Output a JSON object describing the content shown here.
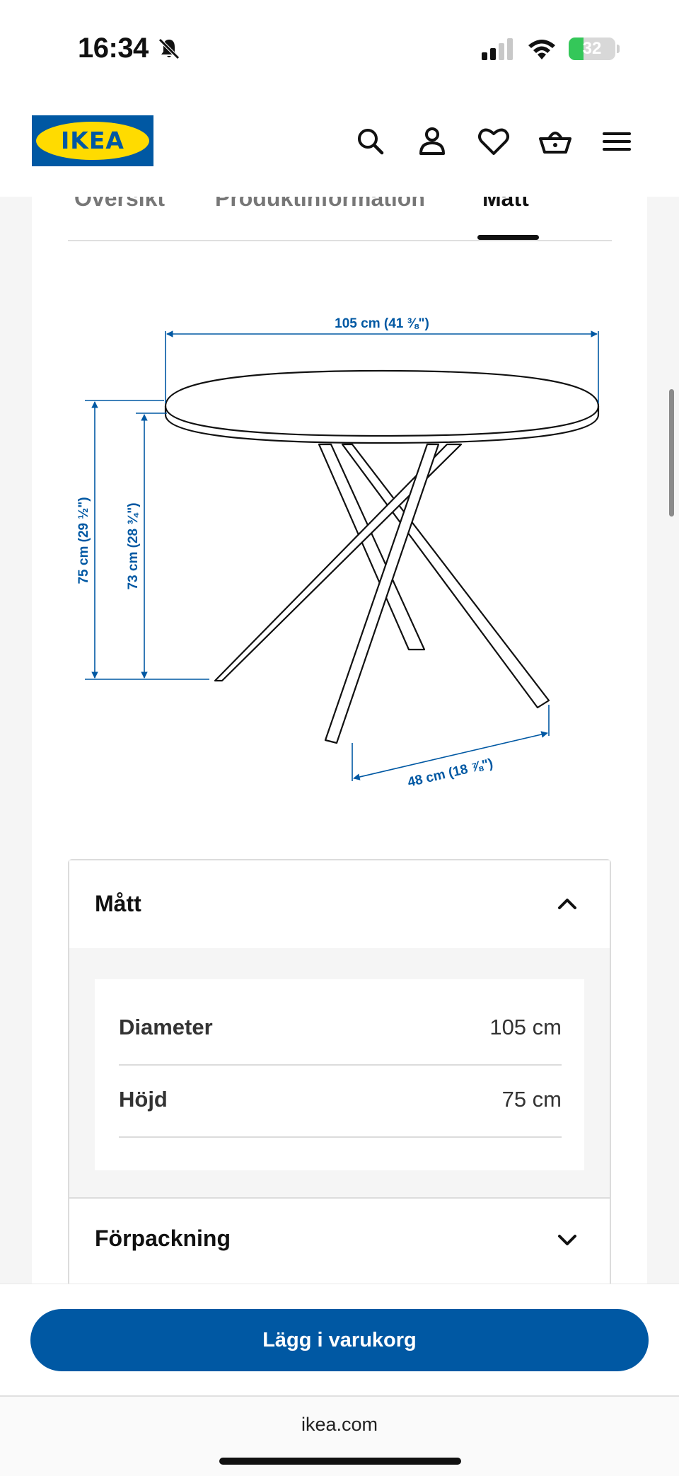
{
  "status_bar": {
    "time": "16:34",
    "battery": "32",
    "icons": [
      "bell-slash-icon",
      "signal-icon",
      "wifi-icon",
      "battery-icon"
    ]
  },
  "header": {
    "logo_text": "IKEA",
    "icons": [
      "search-icon",
      "profile-icon",
      "heart-icon",
      "basket-icon",
      "menu-icon"
    ]
  },
  "tabs": [
    {
      "label": "Översikt",
      "active": false
    },
    {
      "label": "Produktinformation",
      "active": false
    },
    {
      "label": "Mått",
      "active": true
    }
  ],
  "diagram": {
    "width_label": "105 cm (41 ⅜\")",
    "height_label": "75 cm (29 ½\")",
    "inner_height_label": "73 cm (28 ¾\")",
    "base_label": "48 cm (18 ⅞\")",
    "line_color": "#0058a3"
  },
  "accordion": {
    "section1": {
      "title": "Mått",
      "expanded": true,
      "rows": [
        {
          "label": "Diameter",
          "value": "105 cm"
        },
        {
          "label": "Höjd",
          "value": "75 cm"
        }
      ]
    },
    "section2": {
      "title": "Förpackning",
      "expanded": false
    }
  },
  "cart_button": {
    "label": "Lägg i varukorg"
  },
  "browser": {
    "url": "ikea.com"
  },
  "colors": {
    "brand_blue": "#0058a3",
    "brand_yellow": "#ffdb00"
  }
}
